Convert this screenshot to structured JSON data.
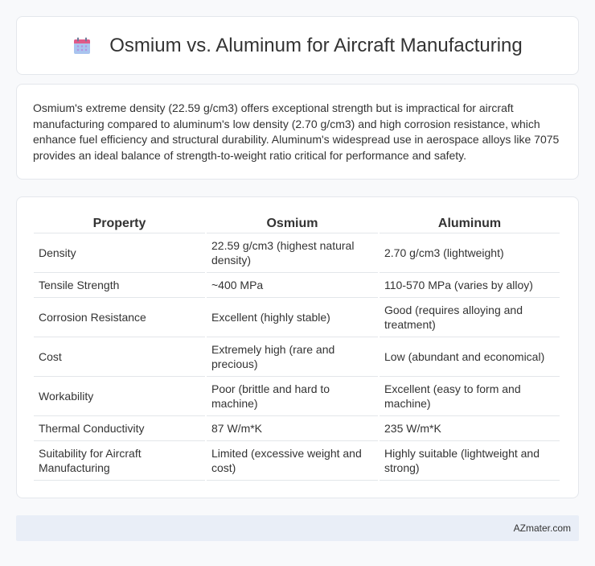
{
  "header": {
    "title": "Osmium vs. Aluminum for Aircraft Manufacturing",
    "icon": "calendar-icon",
    "icon_colors": {
      "top": "#e05a8a",
      "body": "#a9c4ef",
      "dots": "#b58fe0"
    }
  },
  "summary": {
    "text": "Osmium's extreme density (22.59 g/cm3) offers exceptional strength but is impractical for aircraft manufacturing compared to aluminum's low density (2.70 g/cm3) and high corrosion resistance, which enhance fuel efficiency and structural durability. Aluminum's widespread use in aerospace alloys like 7075 provides an ideal balance of strength-to-weight ratio critical for performance and safety."
  },
  "table": {
    "headers": [
      "Property",
      "Osmium",
      "Aluminum"
    ],
    "rows": [
      [
        "Density",
        "22.59 g/cm3 (highest natural density)",
        "2.70 g/cm3 (lightweight)"
      ],
      [
        "Tensile Strength",
        "~400 MPa",
        "110-570 MPa (varies by alloy)"
      ],
      [
        "Corrosion Resistance",
        "Excellent (highly stable)",
        "Good (requires alloying and treatment)"
      ],
      [
        "Cost",
        "Extremely high (rare and precious)",
        "Low (abundant and economical)"
      ],
      [
        "Workability",
        "Poor (brittle and hard to machine)",
        "Excellent (easy to form and machine)"
      ],
      [
        "Thermal Conductivity",
        "87 W/m*K",
        "235 W/m*K"
      ],
      [
        "Suitability for Aircraft Manufacturing",
        "Limited (excessive weight and cost)",
        "Highly suitable (lightweight and strong)"
      ]
    ]
  },
  "footer": {
    "text": "AZmater.com"
  }
}
